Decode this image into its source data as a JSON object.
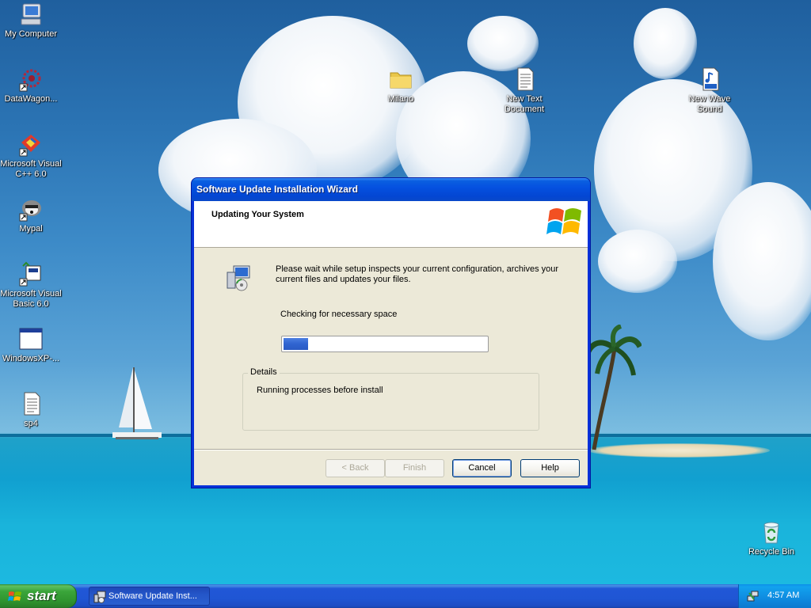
{
  "desktop": {
    "icons": [
      {
        "label": "My Computer"
      },
      {
        "label": "DataWagon..."
      },
      {
        "label": "Microsoft Visual C++ 6.0"
      },
      {
        "label": "Mypal"
      },
      {
        "label": "Microsoft Visual Basic 6.0"
      },
      {
        "label": "WindowsXP-..."
      },
      {
        "label": "sp4"
      },
      {
        "label": "Milano"
      },
      {
        "label": "New Text Document"
      },
      {
        "label": "New Wave Sound"
      },
      {
        "label": "Recycle Bin"
      }
    ]
  },
  "wizard": {
    "title": "Software Update Installation Wizard",
    "header_title": "Updating Your System",
    "message": "Please wait while setup inspects your current configuration, archives your current files and updates your files.",
    "status": "Checking for necessary space",
    "progress_fraction": 0.12,
    "details_legend": "Details",
    "details_text": "Running processes before install",
    "buttons": {
      "back": "< Back",
      "finish": "Finish",
      "cancel": "Cancel",
      "help": "Help"
    }
  },
  "taskbar": {
    "start_label": "start",
    "task_label": "Software Update Inst...",
    "clock": "4:57 AM"
  },
  "colors": {
    "titlebar": "#0551e0",
    "start": "#3aa53a",
    "progress_fill": "#2f63d0",
    "dialog_face": "#ece9d8"
  }
}
